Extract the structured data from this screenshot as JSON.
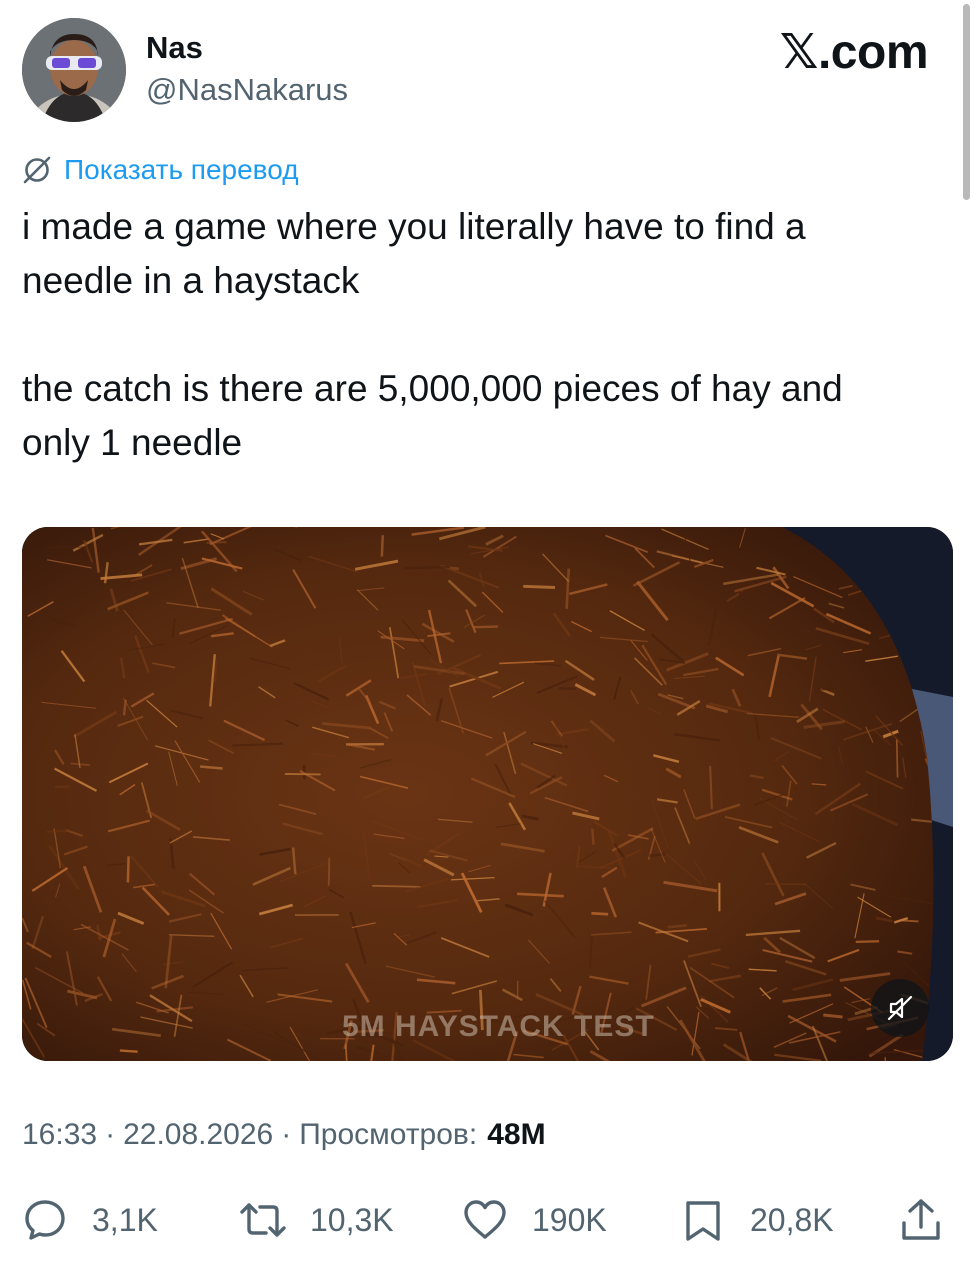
{
  "author": {
    "display_name": "Nas",
    "handle": "@NasNakarus"
  },
  "brand": "𝕏.com",
  "translate": {
    "label": "Показать перевод",
    "icon": "globe-slash-icon"
  },
  "tweet": {
    "paragraphs": [
      "i made a game where you literally have to find a\nneedle in a haystack",
      "the catch is there are 5,000,000 pieces of hay and\nonly 1 needle"
    ]
  },
  "media": {
    "type": "video",
    "caption": "5M HAYSTACK TEST",
    "muted": true,
    "mute_icon": "speaker-muted-icon"
  },
  "meta": {
    "time": "16:33",
    "separator": "·",
    "date": "22.08.2026",
    "views_label": "Просмотров:",
    "views_count": "48M"
  },
  "actions": {
    "replies": {
      "icon": "reply-icon",
      "count": "3,1K"
    },
    "reposts": {
      "icon": "repost-icon",
      "count": "10,3K"
    },
    "likes": {
      "icon": "heart-icon",
      "count": "190K"
    },
    "bookmarks": {
      "icon": "bookmark-icon",
      "count": "20,8K"
    },
    "share": {
      "icon": "share-icon"
    }
  },
  "colors": {
    "accent": "#1d9bf0",
    "text": "#0f1419",
    "secondary": "#536471",
    "hay": "#7a3a16"
  }
}
